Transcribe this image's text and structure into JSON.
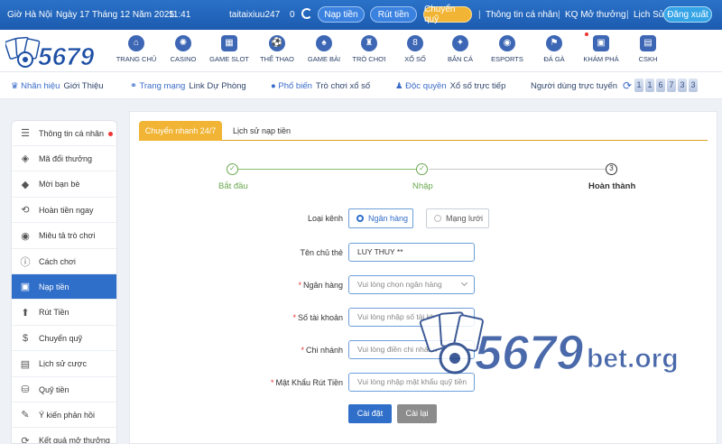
{
  "topbar": {
    "timezone": "Giờ Hà Nội",
    "date": "Ngày 17 Tháng 12 Năm 2025",
    "time": "11:41",
    "username": "taitaixiuu247",
    "balance": "0",
    "deposit_label": "Nạp tiền",
    "withdraw_label": "Rút tiền",
    "transfer_label": "Chuyển quỹ",
    "profile_label": "Thông tin cá nhân",
    "results_label": "KQ Mở thưởng",
    "history_label": "Lịch Sử",
    "logout_label": "Đăng xuất"
  },
  "nav": {
    "items": [
      {
        "label": "TRANG CHỦ",
        "icon": "home-icon"
      },
      {
        "label": "CASINO",
        "icon": "casino-chip-icon"
      },
      {
        "label": "GAME SLOT",
        "icon": "slot-icon"
      },
      {
        "label": "THỂ THAO",
        "icon": "football-icon"
      },
      {
        "label": "GAME BÀI",
        "icon": "spade-icon"
      },
      {
        "label": "TRÒ CHƠI",
        "icon": "joystick-icon"
      },
      {
        "label": "XỔ SỐ",
        "icon": "lottery-ball-icon"
      },
      {
        "label": "BẮN CÁ",
        "icon": "fish-icon"
      },
      {
        "label": "ESPORTS",
        "icon": "gamepad-icon"
      },
      {
        "label": "ĐÁ GÀ",
        "icon": "rooster-icon"
      },
      {
        "label": "KHÁM PHÁ",
        "icon": "gift-icon"
      },
      {
        "label": "CSKH",
        "icon": "chat-icon"
      }
    ]
  },
  "ticker": {
    "brand_label": "Nhãn hiệu",
    "brand_value": "Giới Thiệu",
    "network_label": "Trang mạng",
    "network_value": "Link Dự Phòng",
    "popular_label": "Phổ biến",
    "popular_value": "Trò chơi xổ số",
    "exclusive_label": "Độc quyền",
    "exclusive_value": "Xổ số trực tiếp",
    "online_label": "Người dùng trực tuyến",
    "online_digits": [
      "1",
      "1",
      "6",
      "7",
      "3",
      "3"
    ]
  },
  "sidebar": {
    "items": [
      {
        "label": "Thông tin cá nhân",
        "icon": "user-list-icon"
      },
      {
        "label": "Mã đổi thưởng",
        "icon": "tag-icon"
      },
      {
        "label": "Mời bạn bè",
        "icon": "diamond-icon"
      },
      {
        "label": "Hoàn tiền ngay",
        "icon": "refund-icon"
      },
      {
        "label": "Miêu tả trò chơi",
        "icon": "gamepad-icon"
      },
      {
        "label": "Cách chơi",
        "icon": "info-icon"
      },
      {
        "label": "Nạp tiền",
        "icon": "wallet-icon"
      },
      {
        "label": "Rút Tiền",
        "icon": "withdraw-icon"
      },
      {
        "label": "Chuyển quỹ",
        "icon": "dollar-icon"
      },
      {
        "label": "Lịch sử cược",
        "icon": "document-icon"
      },
      {
        "label": "Quỹ tiền",
        "icon": "coins-icon"
      },
      {
        "label": "Ý kiến phản hồi",
        "icon": "feedback-icon"
      },
      {
        "label": "Kết quả mở thưởng",
        "icon": "results-icon"
      }
    ]
  },
  "tabs": {
    "quick_transfer": "Chuyển nhanh 24/7",
    "deposit_history": "Lịch sử nạp tiền"
  },
  "steps": {
    "start": "Bắt đầu",
    "input": "Nhập",
    "done": "Hoàn thành",
    "done_number": "3"
  },
  "form": {
    "channel_label": "Loại kênh",
    "channel_bank": "Ngân hàng",
    "channel_network": "Mạng lưới",
    "holder_label": "Tên chủ thẻ",
    "holder_value": "LUY THUY **",
    "bank_label": "Ngân hàng",
    "bank_placeholder": "Vui lòng chọn ngân hàng",
    "account_label": "Số tài khoản",
    "account_placeholder": "Vui lòng nhập số tài kh",
    "branch_label": "Chi nhánh",
    "branch_placeholder": "Vui lòng điền chi nhánh",
    "password_label": "Mật Khẩu Rút Tiền",
    "password_placeholder": "Vui lòng nhập mật khẩu quỹ tiền",
    "submit_label": "Cài đặt",
    "reset_label": "Cài lại"
  },
  "logo": {
    "text": "5679"
  },
  "watermark": {
    "number": "5679",
    "suffix": "bet.org"
  },
  "colors": {
    "primary": "#2f6ec9",
    "accent": "#f1b434",
    "success": "#6aa84f",
    "topbar": "#1f62b8"
  }
}
